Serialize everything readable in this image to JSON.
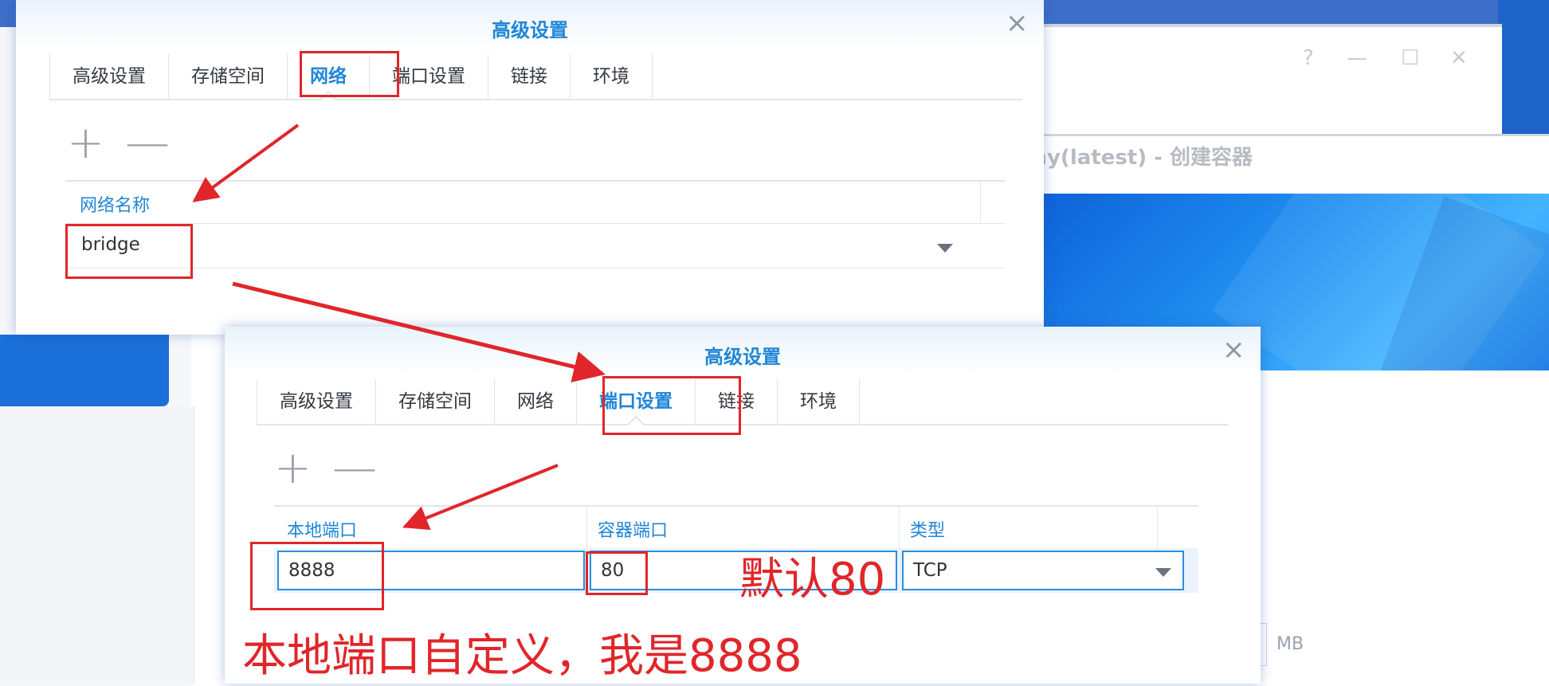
{
  "background": {
    "create_window_title": "shy(latest) - 创建容器",
    "window_controls": [
      "?",
      "—",
      "☐",
      "✕"
    ],
    "unit_label": "MB"
  },
  "dialog_network": {
    "title": "高级设置",
    "tabs": [
      "高级设置",
      "存储空间",
      "网络",
      "端口设置",
      "链接",
      "环境"
    ],
    "active_tab": "网络",
    "toolbar": {
      "add": "+",
      "remove": "—"
    },
    "column_header": "网络名称",
    "network_value": "bridge"
  },
  "dialog_port": {
    "title": "高级设置",
    "tabs": [
      "高级设置",
      "存储空间",
      "网络",
      "端口设置",
      "链接",
      "环境"
    ],
    "active_tab": "端口设置",
    "toolbar": {
      "add": "+",
      "remove": "—"
    },
    "columns": [
      "本地端口",
      "容器端口",
      "类型"
    ],
    "row": {
      "local_port": "8888",
      "container_port": "80",
      "type": "TCP"
    }
  },
  "annotations": {
    "default_note": "默认80",
    "custom_note": "本地端口自定义，我是8888"
  },
  "colors": {
    "accent": "#1f86d6",
    "annotation_red": "#e0262a",
    "banner_blue": "#1f8ef0"
  }
}
